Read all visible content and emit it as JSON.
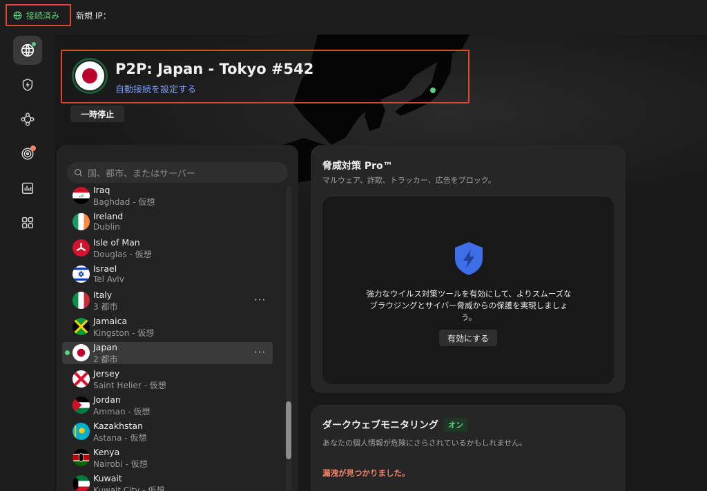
{
  "topbar": {
    "status": "接続済み",
    "new_ip_label": "新規 IP：",
    "status_color": "#58d37b"
  },
  "sidebar": {
    "items": [
      {
        "icon": "globe-icon",
        "active": true,
        "badge": "#58d37b"
      },
      {
        "icon": "shield-bolt-icon",
        "active": false
      },
      {
        "icon": "meshnet-icon",
        "active": false
      },
      {
        "icon": "radar-icon",
        "active": false,
        "badge": "#f2826a"
      },
      {
        "icon": "stats-icon",
        "active": false
      },
      {
        "icon": "apps-grid-icon",
        "active": false
      }
    ]
  },
  "connection": {
    "title": "P2P: Japan - Tokyo #542",
    "autoconnect_link": "自動接続を設定する",
    "pause_label": "一時停止"
  },
  "server_list": {
    "search_placeholder": "国、都市、またはサーバー",
    "rows": [
      {
        "name": "Iraq",
        "sub": "Baghdad - 仮想",
        "flag": "iraq"
      },
      {
        "name": "Ireland",
        "sub": "Dublin",
        "flag": "ireland"
      },
      {
        "name": "Isle of Man",
        "sub": "Douglas - 仮想",
        "flag": "isle-of-man"
      },
      {
        "name": "Israel",
        "sub": "Tel Aviv",
        "flag": "israel"
      },
      {
        "name": "Italy",
        "sub": "3 都市",
        "flag": "italy",
        "more": "···"
      },
      {
        "name": "Jamaica",
        "sub": "Kingston - 仮想",
        "flag": "jamaica"
      },
      {
        "name": "Japan",
        "sub": "2 都市",
        "flag": "japan",
        "more": "···",
        "selected": true
      },
      {
        "name": "Jersey",
        "sub": "Saint Helier - 仮想",
        "flag": "jersey"
      },
      {
        "name": "Jordan",
        "sub": "Amman - 仮想",
        "flag": "jordan"
      },
      {
        "name": "Kazakhstan",
        "sub": "Astana - 仮想",
        "flag": "kazakhstan"
      },
      {
        "name": "Kenya",
        "sub": "Nairobi - 仮想",
        "flag": "kenya"
      },
      {
        "name": "Kuwait",
        "sub": "Kuwait City - 仮想",
        "flag": "kuwait"
      }
    ]
  },
  "threat_protection": {
    "title": "脅威対策 Pro™",
    "description": "マルウェア、詐欺、トラッカー、広告をブロック。",
    "body": "強力なウイルス対策ツールを有効にして、よりスムーズなブラウジングとサイバー脅威からの保護を実現しましょう。",
    "button": "有効にする",
    "accent": "#3e6ee8"
  },
  "dark_web": {
    "title": "ダークウェブモニタリング",
    "badge": "オン",
    "description": "あなたの個人情報が危険にさらされているかもしれません。",
    "alert": "漏洩が見つかりました。",
    "alert_color": "#f2826a"
  }
}
